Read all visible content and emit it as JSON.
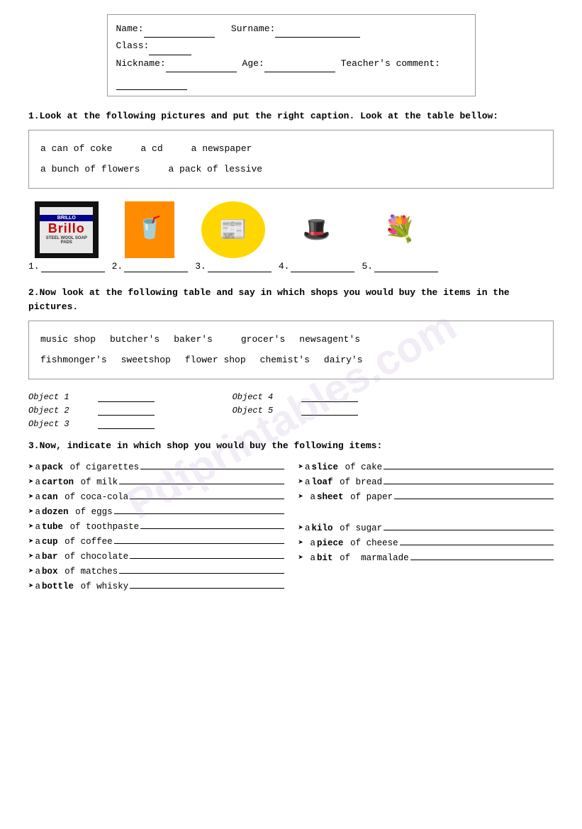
{
  "header": {
    "name_label": "Name:",
    "surname_label": "Surname:",
    "class_label": "Class:",
    "nickname_label": "Nickname:",
    "age_label": "Age:",
    "teachers_comment_label": "Teacher's comment:"
  },
  "section1": {
    "title": "1.Look at the following pictures and put the right caption. Look at the table bellow:",
    "vocab_items": [
      "a can of coke",
      "a cd",
      "a newspaper",
      "a bunch of flowers",
      "a pack of lessive"
    ]
  },
  "images": {
    "labels": [
      "1.",
      "2.",
      "3.",
      "4.",
      "5."
    ]
  },
  "section2": {
    "title": "2.Now look at the following table and say in which shops you would buy the items in the pictures.",
    "shops_row1": [
      "music shop",
      "butcher's",
      "baker's",
      "grocer's",
      "newsagent's"
    ],
    "shops_row2": [
      "fishmonger's",
      "sweetshop",
      "flower shop",
      "chemist's",
      "dairy's"
    ],
    "objects": [
      {
        "label": "Object 1",
        "id": "obj1"
      },
      {
        "label": "Object 4",
        "id": "obj4"
      },
      {
        "label": "Object 2",
        "id": "obj2"
      },
      {
        "label": "Object 5",
        "id": "obj5"
      },
      {
        "label": "Object 3",
        "id": "obj3"
      }
    ]
  },
  "section3": {
    "title": "3.Now, indicate in which shop you would buy the following items:",
    "left_items": [
      {
        "prefix": "➤a ",
        "bold": "pack",
        "rest": " of cigarettes"
      },
      {
        "prefix": "➤a ",
        "bold": "carton",
        "rest": " of milk"
      },
      {
        "prefix": "➤a ",
        "bold": "can",
        "rest": " of coca-cola"
      },
      {
        "prefix": "➤a ",
        "bold": "dozen",
        "rest": " of eggs"
      },
      {
        "prefix": "➤a ",
        "bold": "tube",
        "rest": " of toothpaste"
      },
      {
        "prefix": "➤a ",
        "bold": "cup",
        "rest": " of coffee"
      },
      {
        "prefix": "➤a ",
        "bold": "bar",
        "rest": " of chocolate"
      },
      {
        "prefix": "➤a ",
        "bold": "box",
        "rest": " of matches"
      },
      {
        "prefix": "➤a ",
        "bold": "bottle",
        "rest": " of whisky"
      }
    ],
    "right_items": [
      {
        "prefix": "➤a ",
        "bold": "slice",
        "rest": " of cake"
      },
      {
        "prefix": "➤a ",
        "bold": "loaf",
        "rest": " of bread"
      },
      {
        "prefix": "➤ a ",
        "bold": "sheet",
        "rest": " of paper"
      },
      {
        "prefix": "",
        "bold": "",
        "rest": ""
      },
      {
        "prefix": "➤a ",
        "bold": "kilo",
        "rest": " of sugar"
      },
      {
        "prefix": "➤ a ",
        "bold": "piece",
        "rest": " of cheese"
      },
      {
        "prefix": "➤ a ",
        "bold": "bit",
        "rest": " of  marmalade"
      },
      {
        "prefix": "",
        "bold": "",
        "rest": ""
      },
      {
        "prefix": "",
        "bold": "",
        "rest": ""
      }
    ]
  },
  "watermark": "Pdfprintables.com"
}
